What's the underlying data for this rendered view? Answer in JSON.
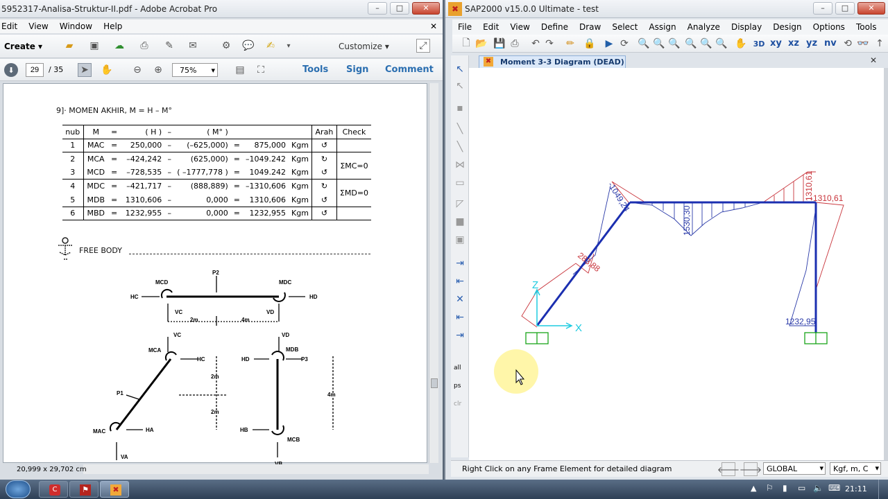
{
  "acrobat": {
    "title": "5952317-Analisa-Struktur-II.pdf - Adobe Acrobat Pro",
    "menu": [
      "Edit",
      "View",
      "Window",
      "Help"
    ],
    "create_label": "Create",
    "customize_label": "Customize",
    "page_current": "29",
    "page_total": "/ 35",
    "zoom": "75%",
    "panel_links": [
      "Tools",
      "Sign",
      "Comment"
    ],
    "page_size": "20,999 x 29,702 cm",
    "doc": {
      "section_title": "9]·  MOMEN AKHIR,   M = H – M°",
      "table_header": [
        "nub",
        "M",
        "=",
        "( H )",
        "–",
        "( M° )",
        "",
        "",
        "Arah",
        "Check"
      ],
      "rows": [
        [
          "1",
          "MAC",
          "=",
          "250,000",
          "–",
          "(–625,000)",
          "=",
          "875,000",
          "Kgm",
          "↺"
        ],
        [
          "2",
          "MCA",
          "=",
          "–424,242",
          "–",
          "(625,000)",
          "=",
          "–1049.242",
          "Kgm",
          "↻"
        ],
        [
          "3",
          "MCD",
          "=",
          "–728,535",
          "–",
          "( –1777,778 )",
          "=",
          "1049.242",
          "Kgm",
          "↺"
        ],
        [
          "4",
          "MDC",
          "=",
          "–421,717",
          "–",
          "(888,889)",
          "=",
          "–1310,606",
          "Kgm",
          "↻"
        ],
        [
          "5",
          "MDB",
          "=",
          "1310,606",
          "–",
          "0,000",
          "=",
          "1310,606",
          "Kgm",
          "↺"
        ],
        [
          "6",
          "MBD",
          "=",
          "1232,955",
          "–",
          "0,000",
          "=",
          "1232,955",
          "Kgm",
          "↺"
        ]
      ],
      "check_1": "ΣMC=0",
      "check_2": "ΣMD=0",
      "free_body_label": "FREE  BODY",
      "fb_labels": {
        "mcd": "MCD",
        "p2": "P2",
        "mdc": "MDC",
        "hc": "HC",
        "hd": "HD",
        "vc": "VC",
        "vd": "VD",
        "d2m": "2m",
        "d4m": "4m",
        "vc2": "VC",
        "vd2": "VD",
        "mca": "MCA",
        "hc2": "HC",
        "mdb": "MDB",
        "hd2": "HD",
        "p3": "P3",
        "d2m_a": "2m",
        "d2m_b": "2m",
        "d4m_v": "4m",
        "p1": "P1",
        "mac": "MAC",
        "ha": "HA",
        "hb": "HB",
        "mcb": "MCB",
        "va": "VA",
        "vb": "VB"
      }
    }
  },
  "sap": {
    "title": "SAP2000 v15.0.0 Ultimate - test",
    "menu": [
      "File",
      "Edit",
      "View",
      "Define",
      "Draw",
      "Select",
      "Assign",
      "Analyze",
      "Display",
      "Design",
      "Options",
      "Tools",
      "Help"
    ],
    "view_buttons": [
      "xy",
      "xz",
      "yz",
      "nv"
    ],
    "tab_title": "Moment 3-3 Diagram   (DEAD)",
    "side_labels": [
      "all",
      "ps",
      "clr"
    ],
    "values": {
      "v1": "-1049,24",
      "v2": "1310,61",
      "v3": "-1310,61",
      "v4": "1530,30",
      "v5": "283,88",
      "v6": "1232,95"
    },
    "axis": {
      "z": "Z",
      "x": "X"
    },
    "status_text": "Right Click on any Frame Element for detailed diagram",
    "coord_system": "GLOBAL",
    "units": "Kgf, m, C"
  },
  "taskbar": {
    "clock": "21:11"
  },
  "colors": {
    "frame": "#1b2fb0",
    "diagram_red": "#c8333a",
    "diagram_blue": "#2a3aa8",
    "axis_cyan": "#1ecbe0",
    "support": "#18a418"
  }
}
